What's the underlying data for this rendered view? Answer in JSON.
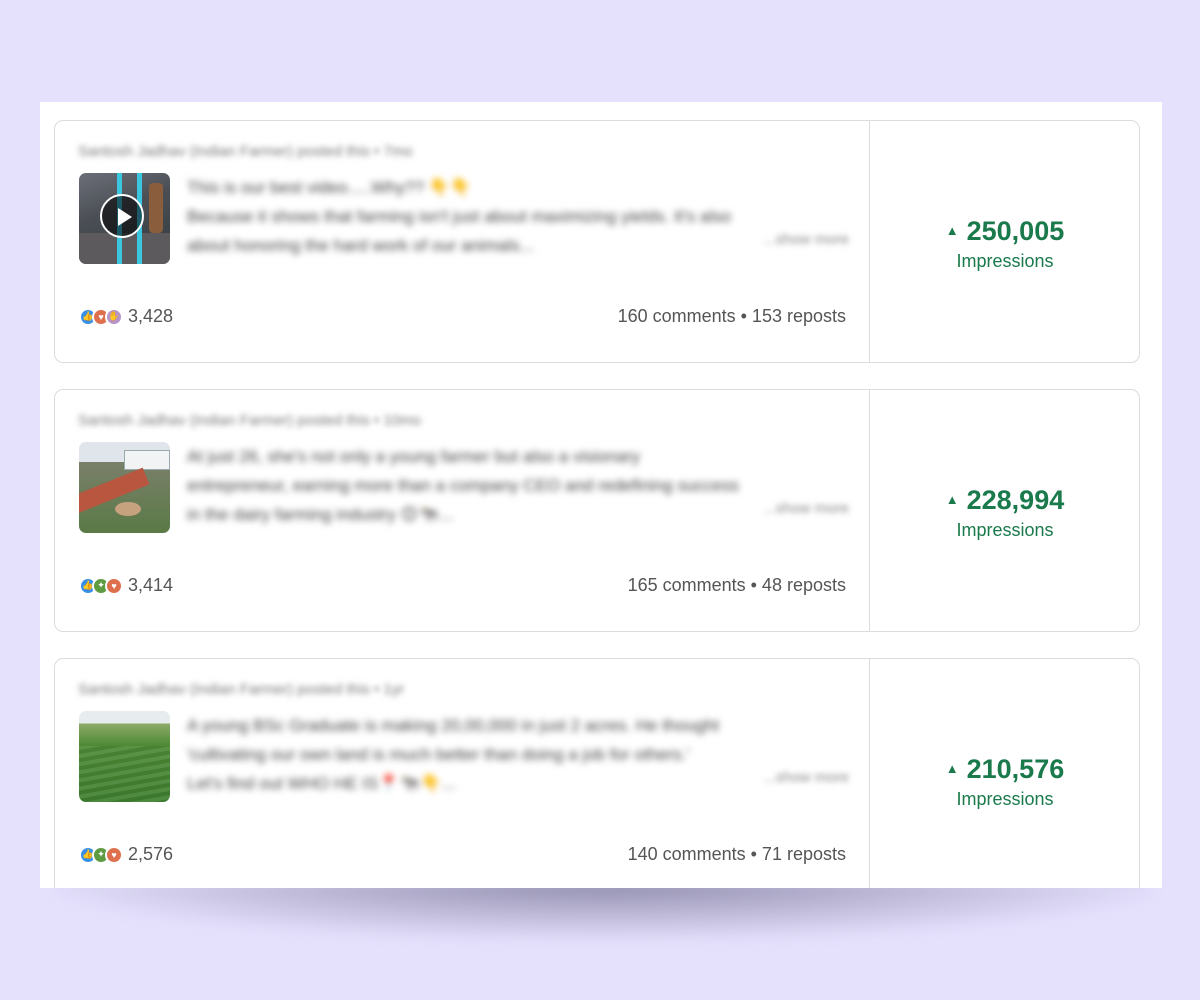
{
  "posts": [
    {
      "header": "Santosh Jadhav (Indian Farmer) posted this • 7mo",
      "text_lines": [
        "This is our best video.....Why?? 👇👇",
        "Because it shows that farming isn't just about maximizing yields. It's also",
        "about honoring the hard work of our animals..."
      ],
      "show_more": "...show more",
      "has_video": true,
      "reactions": [
        "like",
        "love",
        "support"
      ],
      "reaction_count": "3,428",
      "comments_reposts": "160 comments • 153 reposts",
      "impressions_value": "250,005",
      "impressions_label": "Impressions",
      "trend_icon": "triangle-up-icon"
    },
    {
      "header": "Santosh Jadhav (Indian Farmer) posted this • 10mo",
      "text_lines": [
        "At just 26, she's not only a young farmer but also a visionary",
        "entrepreneur, earning more than a company CEO and redefining success",
        "in the dairy farming industry 😊🐄..."
      ],
      "show_more": "...show more",
      "has_video": false,
      "reactions": [
        "like",
        "insight",
        "love"
      ],
      "reaction_count": "3,414",
      "comments_reposts": "165 comments • 48 reposts",
      "impressions_value": "228,994",
      "impressions_label": "Impressions",
      "trend_icon": "triangle-up-icon"
    },
    {
      "header": "Santosh Jadhav (Indian Farmer) posted this • 1yr",
      "text_lines": [
        "A young BSc Graduate is making 20,00,000 in just 2 acres. He thought",
        "'cultivating our own land is much better than doing a job for others.'",
        "Let's find out WHO HE IS📍🐄👇..."
      ],
      "show_more": "...show more",
      "has_video": false,
      "reactions": [
        "like",
        "insight",
        "love"
      ],
      "reaction_count": "2,576",
      "comments_reposts": "140 comments • 71 reposts",
      "impressions_value": "210,576",
      "impressions_label": "Impressions",
      "trend_icon": "triangle-up-icon"
    }
  ],
  "colors": {
    "background": "#e5e1fd",
    "impressions_green": "#1a7a4c",
    "like_blue": "#378fe9",
    "love_orange": "#df704d",
    "insight_green": "#5f9b41"
  }
}
